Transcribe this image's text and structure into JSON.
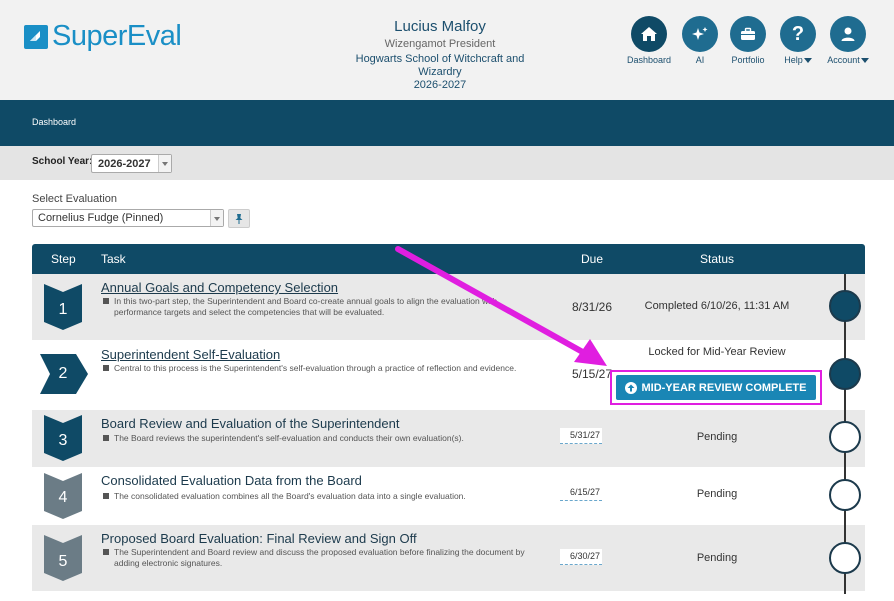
{
  "header": {
    "logo_text": "SuperEval",
    "user_name": "Lucius Malfoy",
    "user_role": "Wizengamot President",
    "user_org": "Hogwarts School of Witchcraft and Wizardry",
    "user_year": "2026-2027"
  },
  "nav": {
    "dashboard": "Dashboard",
    "ai": "AI",
    "portfolio": "Portfolio",
    "help": "Help",
    "account": "Account"
  },
  "dashbar": {
    "label": "Dashboard"
  },
  "school_year": {
    "label": "School Year:",
    "value": "2026-2027"
  },
  "select_evaluation": {
    "label": "Select Evaluation",
    "value": "Cornelius Fudge (Pinned)"
  },
  "table": {
    "headers": {
      "step": "Step",
      "task": "Task",
      "due": "Due",
      "status": "Status"
    },
    "rows": [
      {
        "step": "1",
        "title": "Annual Goals and Competency Selection",
        "desc": "In this two-part step, the Superintendent and Board co-create annual goals to align the evaluation with performance targets and select the competencies that will be evaluated.",
        "due": "8/31/26",
        "status": "Completed 6/10/26, 11:31 AM"
      },
      {
        "step": "2",
        "title": "Superintendent Self-Evaluation",
        "desc": "Central to this process is the Superintendent's self-evaluation through a practice of reflection and evidence.",
        "due": "5/15/27",
        "status": "Locked for Mid-Year Review",
        "button": "MID-YEAR REVIEW COMPLETE"
      },
      {
        "step": "3",
        "title": "Board Review and Evaluation of the Superintendent",
        "desc": "The Board reviews the superintendent's self-evaluation and conducts their own evaluation(s).",
        "due": "5/31/27",
        "status": "Pending"
      },
      {
        "step": "4",
        "title": "Consolidated Evaluation Data from the Board",
        "desc": "The consolidated evaluation combines all the Board's evaluation data into a single evaluation.",
        "due": "6/15/27",
        "status": "Pending"
      },
      {
        "step": "5",
        "title": "Proposed Board Evaluation: Final Review and Sign Off",
        "desc": "The Superintendent and Board review and discuss the proposed evaluation before finalizing the document by adding electronic signatures.",
        "due": "6/30/27",
        "status": "Pending"
      }
    ]
  },
  "colors": {
    "primary_dark": "#0f4a66",
    "accent_blue": "#1a86b5",
    "highlight_magenta": "#e01ee0",
    "step_grey": "#6b7c86"
  }
}
